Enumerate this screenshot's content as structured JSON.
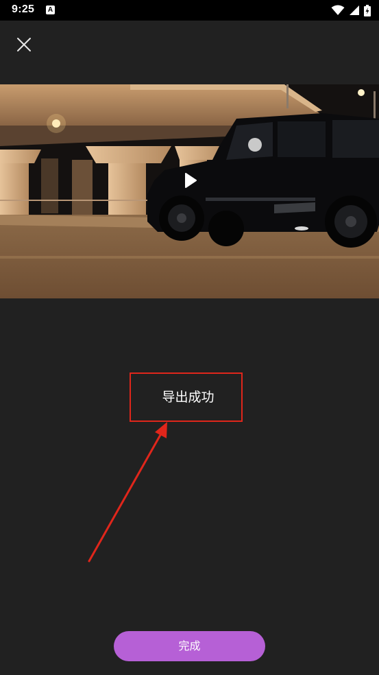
{
  "status_bar": {
    "time": "9:25",
    "notification_icon": "a-icon",
    "wifi_icon": "wifi-icon",
    "signal_icon": "signal-icon",
    "battery_icon": "battery-charging-icon"
  },
  "toolbar": {
    "close_icon": "close-icon"
  },
  "preview": {
    "play_icon": "play-icon"
  },
  "message": {
    "text": "导出成功"
  },
  "footer": {
    "done_label": "完成"
  },
  "colors": {
    "background": "#212121",
    "accent": "#b660d6",
    "annotation": "#e0261b"
  }
}
